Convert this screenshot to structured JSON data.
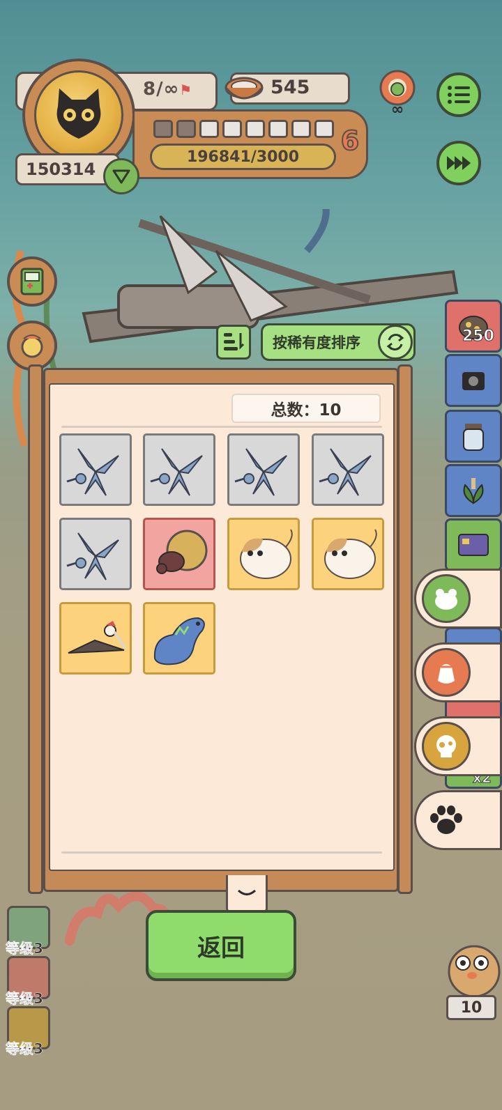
{
  "hud": {
    "capacity": "8/∞",
    "food": "545",
    "coins": "150314",
    "level": "6",
    "xp": "196841/3000",
    "level_segments_filled": 2,
    "level_segments_total": 8
  },
  "sort": {
    "label": "按稀有度排序"
  },
  "board": {
    "total_label": "总数：10",
    "total_count": 10,
    "cards": [
      {
        "rarity": "common",
        "creature": "pterosaur-blue"
      },
      {
        "rarity": "common",
        "creature": "pterosaur-blue"
      },
      {
        "rarity": "common",
        "creature": "pterosaur-blue"
      },
      {
        "rarity": "common",
        "creature": "pterosaur-blue"
      },
      {
        "rarity": "common",
        "creature": "pterosaur-blue"
      },
      {
        "rarity": "epic",
        "creature": "dung-beetle"
      },
      {
        "rarity": "rare",
        "creature": "hamster"
      },
      {
        "rarity": "rare",
        "creature": "hamster"
      },
      {
        "rarity": "rare",
        "creature": "pteranodon"
      },
      {
        "rarity": "rare",
        "creature": "blue-dinosaur"
      }
    ]
  },
  "back_button": "返回",
  "inventory": {
    "count_top": "250",
    "x2_label_a": "x2",
    "x2_label_b": "x2"
  },
  "levels": [
    {
      "label": "等级3"
    },
    {
      "label": "等级3"
    },
    {
      "label": "等级3"
    }
  ],
  "corner_count": "10",
  "colors": {
    "common": "#d8d8d8",
    "epic": "#f2a5a0",
    "rare": "#fcd37c",
    "button_green": "#8fdc6c",
    "board_bg": "#fde9d8",
    "frame_wood": "#c48a57"
  }
}
